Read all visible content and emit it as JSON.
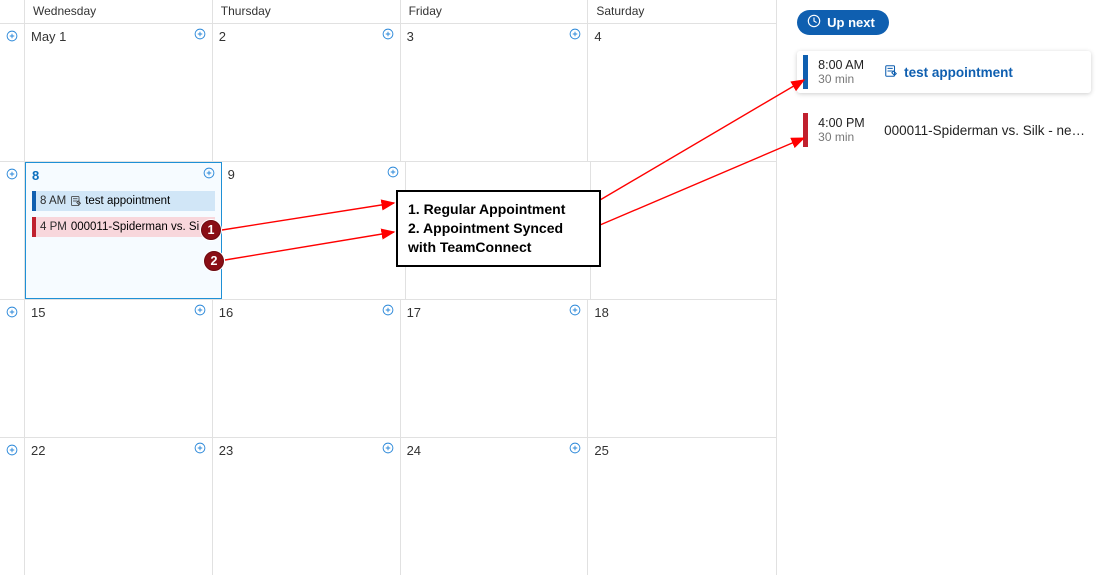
{
  "calendar": {
    "headers": [
      "Wednesday",
      "Thursday",
      "Friday",
      "Saturday"
    ],
    "weeks": [
      [
        "May 1",
        "2",
        "3",
        "4"
      ],
      [
        "8",
        "9",
        "",
        ""
      ],
      [
        "15",
        "16",
        "17",
        "18"
      ],
      [
        "22",
        "23",
        "24",
        "25"
      ]
    ],
    "today_index": {
      "week": 1,
      "col": 0
    },
    "events_wk1_wed": [
      {
        "time": "8 AM",
        "title": "test appointment",
        "color": "blue",
        "icon": true
      },
      {
        "time": "4 PM",
        "title": "000011-Spiderman vs. Si…",
        "color": "red",
        "icon": false
      }
    ]
  },
  "upnext": {
    "label": "Up next",
    "items": [
      {
        "time": "8:00 AM",
        "duration": "30 min",
        "title": "test appointment",
        "color": "blue",
        "icon": true
      },
      {
        "time": "4:00 PM",
        "duration": "30 min",
        "title": "000011-Spiderman vs. Silk - ne…",
        "color": "red",
        "icon": false
      }
    ]
  },
  "annotation": {
    "line1": "1. Regular Appointment",
    "line2": "2. Appointment Synced",
    "line3": "with TeamConnect",
    "marker1": "1",
    "marker2": "2"
  },
  "colors": {
    "accent_blue": "#0f5fb0",
    "accent_red": "#c0202e",
    "marker": "#8a0e15"
  }
}
